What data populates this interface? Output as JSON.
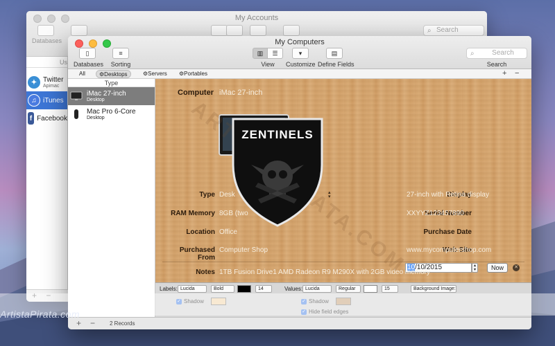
{
  "colors": {
    "accent": "#3d76d6",
    "wood": "#d4a36c",
    "selection_gray": "#7d7d7d"
  },
  "back_window": {
    "title": "My Accounts",
    "toolbar": {
      "databases_label": "Databases",
      "search_placeholder": "Search"
    },
    "column_header": "Us",
    "accounts": [
      {
        "name": "Twitter",
        "sub": "Apimac",
        "icon": "twitter-bird-icon"
      },
      {
        "name": "iTunes",
        "sub": "",
        "icon": "itunes-note-icon"
      },
      {
        "name": "Facebook",
        "sub": "",
        "icon": "facebook-f-icon"
      }
    ],
    "bottom": {
      "add": "+",
      "remove": "−"
    }
  },
  "front_window": {
    "title": "My Computers",
    "toolbar": {
      "databases": "Databases",
      "sorting": "Sorting",
      "view": "View",
      "customize": "Customize",
      "define_fields": "Define Fields",
      "search_label": "Search",
      "search_placeholder": "Search"
    },
    "filters": {
      "all": "All",
      "desktops": "Desktops",
      "servers": "Servers",
      "portables": "Portables",
      "add": "+",
      "remove": "−"
    },
    "list": {
      "column_header": "Type",
      "items": [
        {
          "name": "iMac 27-inch",
          "kind": "Desktop"
        },
        {
          "name": "Mac Pro 6-Core",
          "kind": "Desktop"
        }
      ]
    },
    "detail": {
      "computer_label": "Computer",
      "computer_value": "iMac 27-inch",
      "type_label": "Type",
      "type_value": "Desk",
      "display_label": "Display",
      "display_value": "27-inch with Retina display",
      "ram_label": "RAM Memory",
      "ram_value": "8GB (two",
      "serial_label": "Serial Number",
      "serial_value": "XXYYZ123457890",
      "location_label": "Location",
      "location_value": "Office",
      "purchase_date_label": "Purchase Date",
      "purchase_date_day": "10",
      "purchase_date_rest": "/10/2015",
      "now_button": "Now",
      "purchased_from_label": "Purchased From",
      "purchased_from_value": "Computer Shop",
      "website_label": "Web Site",
      "website_value": "www.mycomputershop.com",
      "notes_label": "Notes",
      "notes_value": "1TB Fusion Drive1 AMD Radeon R9 M290X with 2GB video memory"
    },
    "style_bar": {
      "labels_title": "Labels:",
      "labels_font": "Lucida",
      "labels_weight": "Bold",
      "labels_size": "14",
      "values_title": "Values:",
      "values_font": "Lucida",
      "values_weight": "Regular",
      "values_size": "15",
      "background_image": "Background Image:",
      "shadow_left": "Shadow",
      "shadow_right": "Shadow",
      "hide_field_edges": "Hide field edges"
    },
    "bottom": {
      "add": "+",
      "remove": "−",
      "records": "2 Records"
    }
  },
  "overlays": {
    "shield_text": "ZENTINELS",
    "watermark": "ArtistaPirata.com",
    "diagonal_watermark": "ARTISTAPIRATA.COM"
  }
}
